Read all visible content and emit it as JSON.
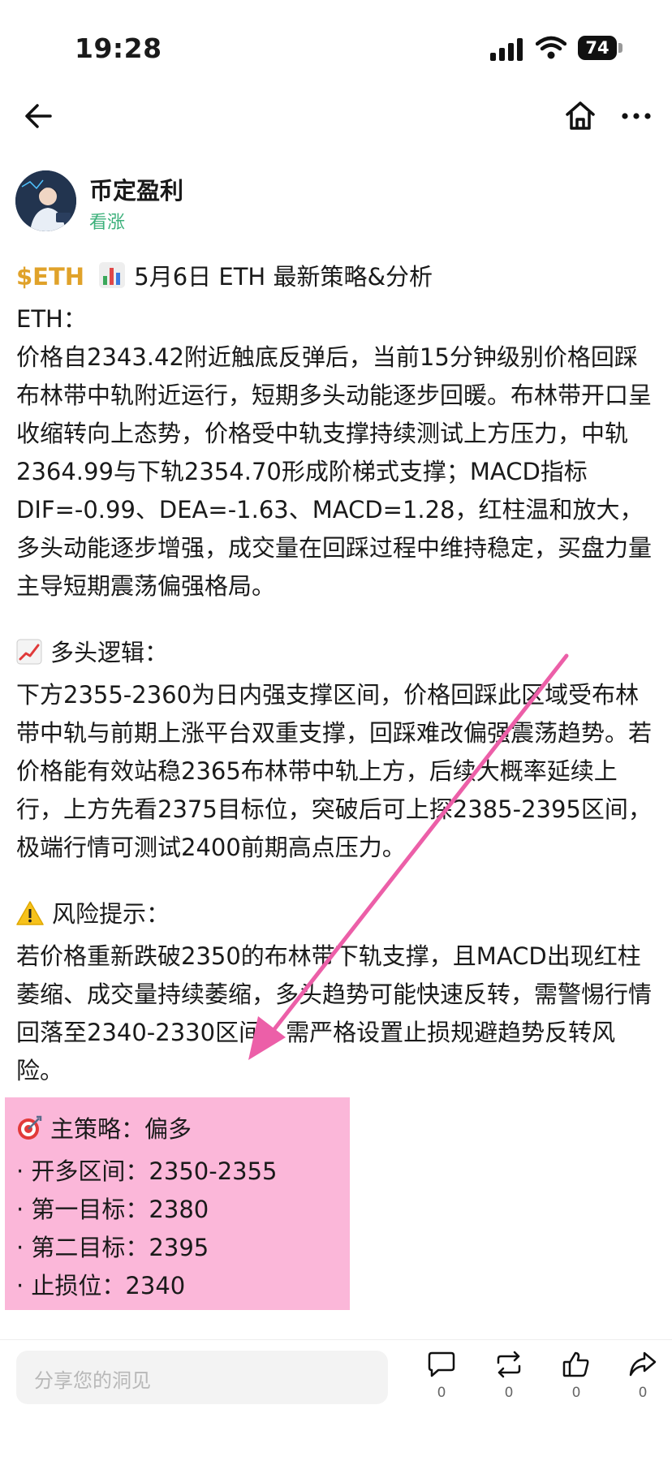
{
  "status_bar": {
    "time": "19:28",
    "battery": "74"
  },
  "author": {
    "name": "币定盈利",
    "tag": "看涨"
  },
  "post": {
    "ticker": "$ETH",
    "title": "5月6日 ETH 最新策略&分析",
    "line_eth": "ETH：",
    "analysis": "价格自2343.42附近触底反弹后，当前15分钟级别价格回踩布林带中轨附近运行，短期多头动能逐步回暖。布林带开口呈收缩转向上态势，价格受中轨支撑持续测试上方压力，中轨2364.99与下轨2354.70形成阶梯式支撑；MACD指标DIF=-0.99、DEA=-1.63、MACD=1.28，红柱温和放大，多头动能逐步增强，成交量在回踩过程中维持稳定，买盘力量主导短期震荡偏强格局。",
    "bull_heading": "多头逻辑：",
    "bull_text": "下方2355-2360为日内强支撑区间，价格回踩此区域受布林带中轨与前期上涨平台双重支撑，回踩难改偏强震荡趋势。若价格能有效站稳2365布林带中轨上方，后续大概率延续上行，上方先看2375目标位，突破后可上探2385-2395区间，极端行情可测试2400前期高点压力。",
    "risk_heading": "风险提示：",
    "risk_text": "若价格重新跌破2350的布林带下轨支撑，且MACD出现红柱萎缩、成交量持续萎缩，多头趋势可能快速反转，需警惕行情回落至2340-2330区间，需严格设置止损规避趋势反转风险。",
    "strategy_heading": "主策略：偏多",
    "strategy_items": [
      "· 开多区间：2350-2355",
      "· 第一目标：2380",
      "· 第二目标：2395",
      "· 止损位：2340"
    ]
  },
  "bottom_bar": {
    "comment_placeholder": "分享您的洞见",
    "comment_count": "0",
    "repost_count": "0",
    "like_count": "0",
    "share_count": "0"
  },
  "colors": {
    "accent_ticker": "#e0a22a",
    "tag_green": "#3bb07a",
    "highlight_pink": "#fbb7d9",
    "arrow_pink": "#ec5fa8"
  }
}
